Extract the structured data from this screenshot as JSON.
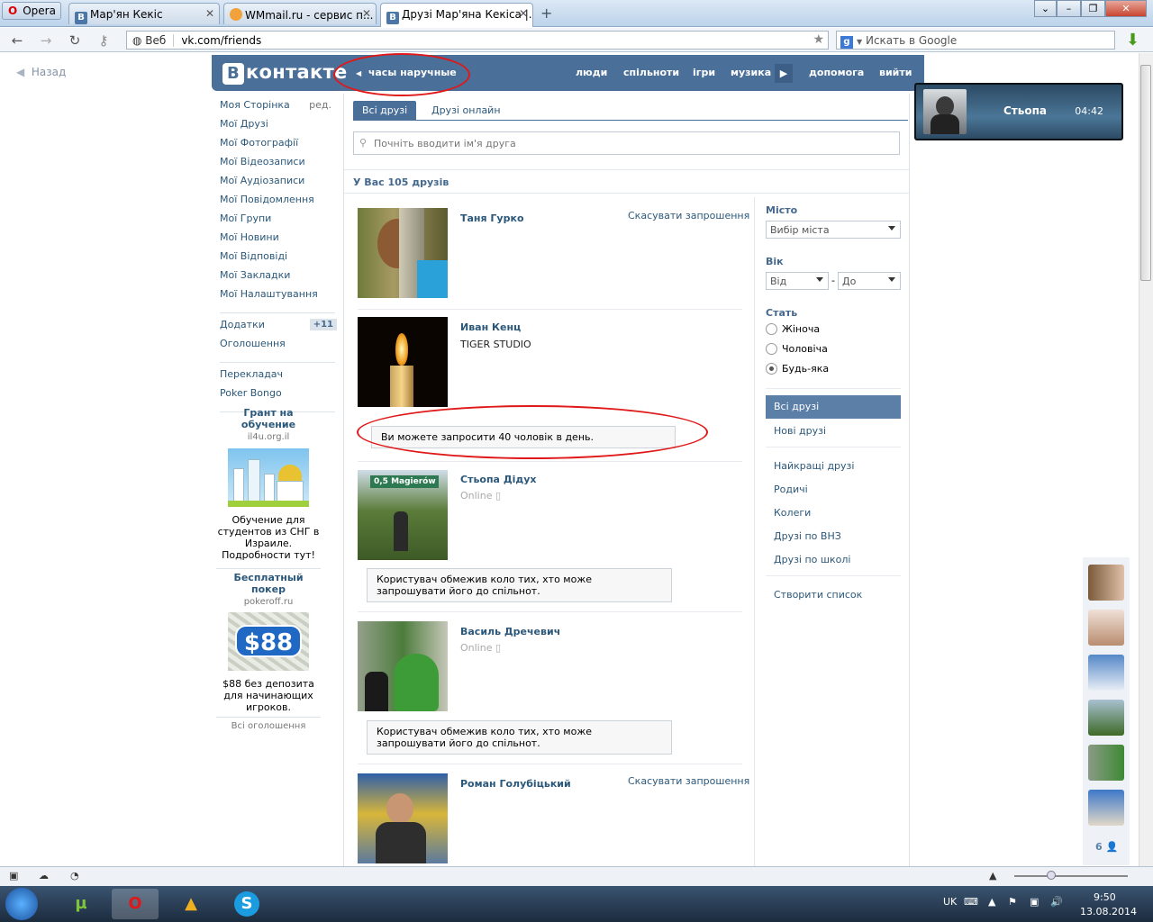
{
  "browser": {
    "menu_label": "Opera",
    "tabs": [
      {
        "title": "Мар'ян Кекіс",
        "favicon": "В"
      },
      {
        "title": "WMmail.ru - сервис п...",
        "favicon": ""
      },
      {
        "title": "Друзі Мар'яна Кекіса |...",
        "favicon": "В"
      }
    ],
    "address_prefix": "Веб",
    "url": "vk.com/friends",
    "search_placeholder": "Искать в Google",
    "search_engine_letter": "g"
  },
  "page": {
    "back_label": "Назад",
    "header": {
      "logo_letter": "В",
      "logo_text": "контакте",
      "status_text": "часы наручные",
      "nav": [
        "люди",
        "спільноти",
        "ігри",
        "музика",
        "допомога",
        "вийти"
      ]
    },
    "left_menu": {
      "items": [
        "Моя Сторінка",
        "Мої Друзі",
        "Мої Фотографії",
        "Мої Відеозаписи",
        "Мої Аудіозаписи",
        "Мої Повідомлення",
        "Мої Групи",
        "Мої Новини",
        "Мої Відповіді",
        "Мої Закладки",
        "Мої Налаштування"
      ],
      "edit_label": "ред.",
      "apps_label": "Додатки",
      "apps_badge": "+11",
      "ads_label": "Оголошення",
      "extra": [
        "Перекладач",
        "Poker Bongo"
      ]
    },
    "ads": [
      {
        "title": "Грант на обучение",
        "domain": "il4u.org.il",
        "text": "Обучение для студентов из СНГ в Израиле. Подробности тут!"
      },
      {
        "title": "Бесплатный покер",
        "domain": "pokeroff.ru",
        "image_text": "$88",
        "text": "$88 без депозита для начинающих игроков."
      }
    ],
    "all_ads_label": "Всі оголошення",
    "friends": {
      "tabs": [
        "Всі друзі",
        "Друзі онлайн"
      ],
      "search_placeholder": "Почніть вводити ім'я друга",
      "count_text": "У Вас 105 друзів",
      "list": [
        {
          "name": "Таня Гурко",
          "action": "Скасувати запрошення"
        },
        {
          "name": "Иван Кенц",
          "subtitle": "TIGER STUDIO",
          "message": "Ви можете запросити 40 чоловік в день."
        },
        {
          "name": "Стьопа Дідух",
          "status": "Online",
          "sign_text": "0,5 Magierów",
          "message": "Користувач обмежив коло тих, хто може запрошувати його до спільнот."
        },
        {
          "name": "Василь Дречевич",
          "status": "Online",
          "message": "Користувач обмежив коло тих, хто може запрошувати його до спільнот."
        },
        {
          "name": "Роман Голубіцький",
          "action": "Скасувати запрошення"
        }
      ]
    },
    "filters": {
      "city_label": "Місто",
      "city_value": "Вибір міста",
      "age_label": "Вік",
      "age_from": "Від",
      "age_dash": "-",
      "age_to": "До",
      "sex_label": "Стать",
      "sex_options": [
        "Жіноча",
        "Чоловіча",
        "Будь-яка"
      ],
      "lists": [
        "Всі друзі",
        "Нові друзі"
      ],
      "categories": [
        "Найкращі друзі",
        "Родичі",
        "Колеги",
        "Друзі по ВНЗ",
        "Друзі по школі"
      ],
      "create_list": "Створити список"
    },
    "popup": {
      "name": "Стьопа",
      "time": "04:42"
    },
    "online_count": "6"
  },
  "taskbar": {
    "lang": "UK",
    "time": "9:50",
    "date": "13.08.2014"
  },
  "colors": {
    "vk_blue": "#4a6f99",
    "link": "#2b587a",
    "annotation": "#e01818"
  }
}
